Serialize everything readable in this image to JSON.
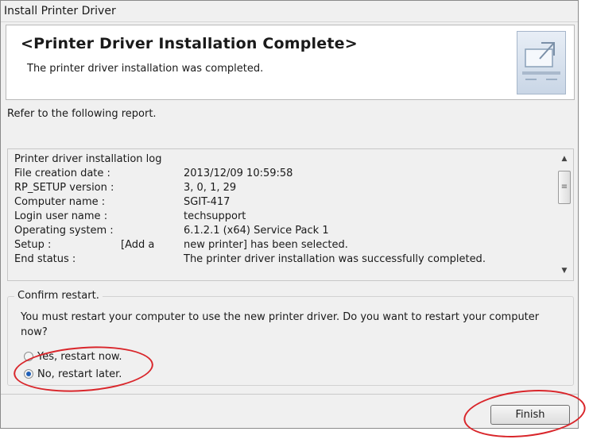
{
  "window": {
    "title": "Install Printer Driver"
  },
  "header": {
    "title": "<Printer Driver Installation Complete>",
    "subtitle": "The printer driver installation was completed.",
    "icon": "installer-computer-icon"
  },
  "intro_text": "Refer to the following report.",
  "log": {
    "heading": "Printer driver installation log",
    "rows": [
      {
        "label": "File creation date :",
        "value": "2013/12/09 10:59:58"
      },
      {
        "label": "RP_SETUP version :",
        "value": "3, 0, 1, 29"
      },
      {
        "label": "Computer name :",
        "value": "SGIT-417"
      },
      {
        "label": "Login user name :",
        "value": "techsupport"
      },
      {
        "label": "Operating system :",
        "value": "6.1.2.1 (x64) Service Pack 1"
      }
    ],
    "setup": {
      "label": "Setup :",
      "pre": "[Add a",
      "value": "new printer] has been selected."
    },
    "end_status": {
      "label": "End status :",
      "value": "The printer driver installation was successfully completed."
    }
  },
  "restart": {
    "legend": "Confirm restart.",
    "message": "You must restart your computer to use the new printer driver. Do you want to restart your computer now?",
    "options": [
      {
        "label": "Yes, restart now.",
        "checked": false
      },
      {
        "label": "No, restart later.",
        "checked": true
      }
    ]
  },
  "buttons": {
    "finish": "Finish"
  },
  "annotation_color": "#d9262b"
}
